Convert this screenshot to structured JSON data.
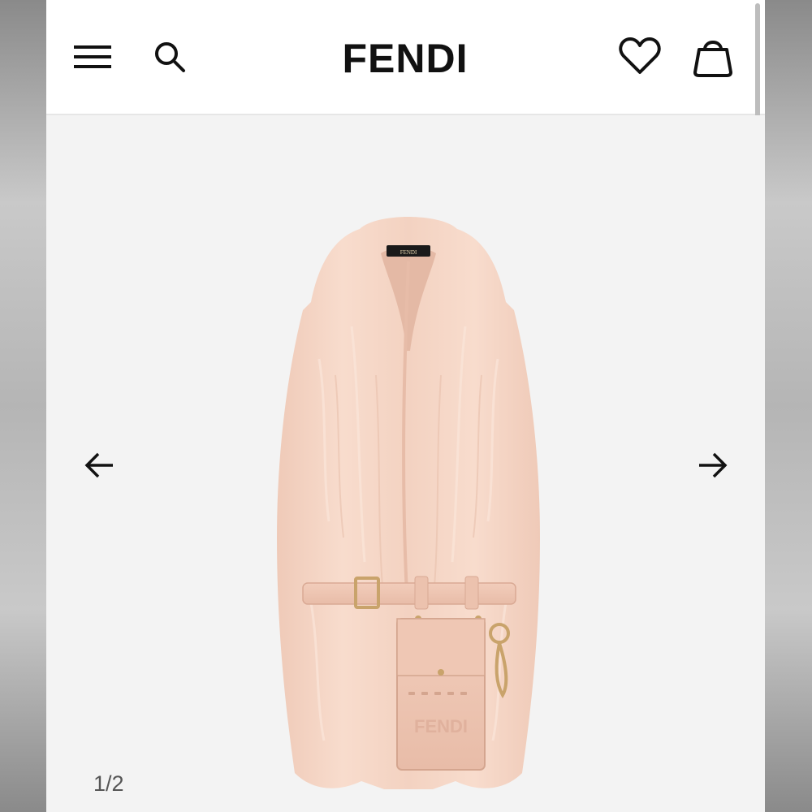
{
  "header": {
    "brand": "FENDI",
    "icons": {
      "menu": "hamburger-menu-icon",
      "search": "search-icon",
      "favorites": "heart-icon",
      "bag": "shopping-bag-icon"
    }
  },
  "gallery": {
    "counter": "1/2",
    "current_index": 1,
    "total": 2,
    "product_image_alt": "product image",
    "product_label_text": "FENDI",
    "prev_icon": "arrow-left-icon",
    "next_icon": "arrow-right-icon"
  },
  "colors": {
    "background": "#f3f3f3",
    "header": "#ffffff",
    "fur": "#f6d7c8",
    "leather": "#f0c8b6",
    "hardware": "#c9a36b",
    "text": "#111111"
  }
}
